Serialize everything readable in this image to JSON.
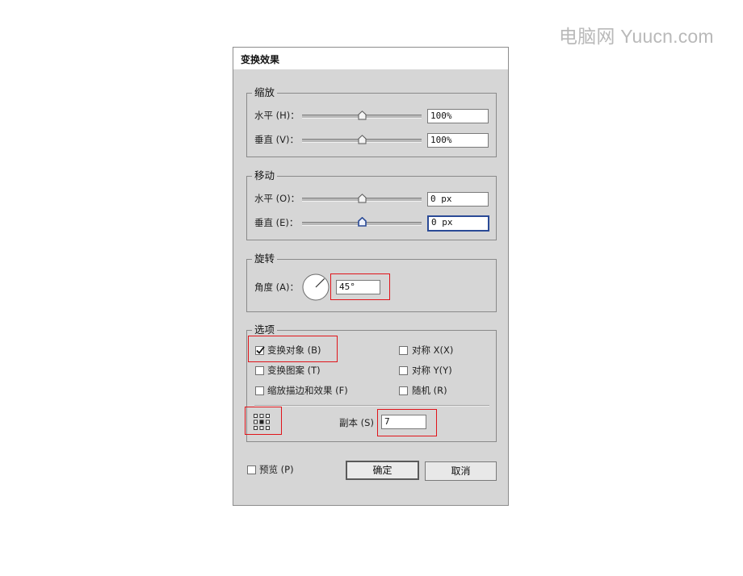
{
  "watermark": "电脑网 Yuucn.com",
  "dialog": {
    "title": "变换效果",
    "scale": {
      "legend": "缩放",
      "horizontal": {
        "label": "水平 (H)：",
        "value": "100%",
        "slider_fraction": 0.5
      },
      "vertical": {
        "label": "垂直 (V)：",
        "value": "100%",
        "slider_fraction": 0.5
      }
    },
    "move": {
      "legend": "移动",
      "horizontal": {
        "label": "水平 (O)：",
        "value": "0 px",
        "slider_fraction": 0.5
      },
      "vertical": {
        "label": "垂直 (E)：",
        "value": "0 px",
        "slider_fraction": 0.5
      }
    },
    "rotate": {
      "legend": "旋转",
      "angle_label": "角度 (A)：",
      "angle_value": "45°",
      "angle_degrees": 45
    },
    "options": {
      "legend": "选项",
      "transform_objects": {
        "label": "变换对象 (B)",
        "checked": true
      },
      "transform_patterns": {
        "label": "变换图案 (T)",
        "checked": false
      },
      "scale_strokes": {
        "label": "缩放描边和效果 (F)",
        "checked": false
      },
      "reflect_x": {
        "label": "对称 X(X)",
        "checked": false
      },
      "reflect_y": {
        "label": "对称 Y(Y)",
        "checked": false
      },
      "random": {
        "label": "随机 (R)",
        "checked": false
      },
      "copies_label": "副本 (S)",
      "copies_value": "7"
    },
    "preview": {
      "label": "预览 (P)",
      "checked": false
    },
    "ok_label": "确定",
    "cancel_label": "取消"
  },
  "colors": {
    "dialog_bg": "#d6d6d6",
    "highlight_red": "#e0141a",
    "focus_blue": "#2a4a96"
  },
  "icons": {
    "reference_point": "reference-point-grid-icon",
    "angle_dial": "angle-dial-icon",
    "check": "check-icon"
  }
}
